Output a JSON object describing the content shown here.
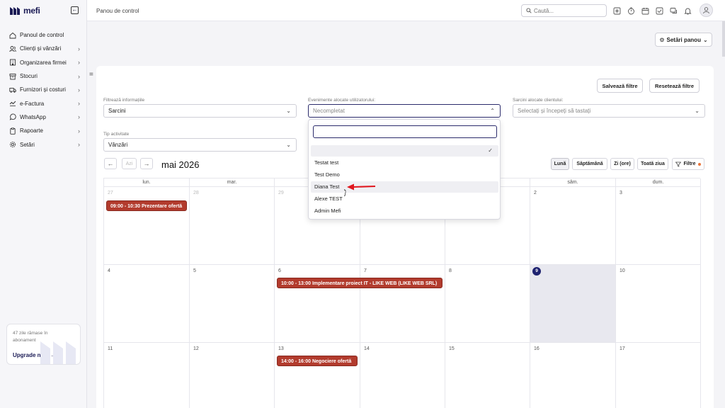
{
  "app": {
    "brand": "mefi"
  },
  "sidebar": {
    "items": [
      {
        "label": "Panoul de control",
        "icon": "home-icon",
        "chevron": false
      },
      {
        "label": "Clienți și vânzări",
        "icon": "users-icon",
        "chevron": true
      },
      {
        "label": "Organizarea firmei",
        "icon": "building-icon",
        "chevron": true
      },
      {
        "label": "Stocuri",
        "icon": "box-icon",
        "chevron": true
      },
      {
        "label": "Furnizori și costuri",
        "icon": "truck-icon",
        "chevron": true
      },
      {
        "label": "e-Factura",
        "icon": "efactura-icon",
        "chevron": true
      },
      {
        "label": "WhatsApp",
        "icon": "whatsapp-icon",
        "chevron": true
      },
      {
        "label": "Rapoarte",
        "icon": "report-icon",
        "chevron": true
      },
      {
        "label": "Setări",
        "icon": "gear-icon",
        "chevron": true
      }
    ],
    "upgrade": {
      "days_text": "47 zile rămase în abonament",
      "cta": "Upgrade now"
    }
  },
  "topbar": {
    "breadcrumb": "Panou de control",
    "search_placeholder": "Caută..."
  },
  "content": {
    "settings_button": "Setări panou",
    "save_filters": "Salvează filtre",
    "reset_filters": "Resetează filtre",
    "filters": {
      "info_label": "Filtrează informațiile",
      "info_value": "Sarcini",
      "events_label": "Evenimente alocate utilizatorului:",
      "events_value": "Necompletat",
      "tasks_label": "Sarcini alocate clientului:",
      "tasks_placeholder": "Selectați și începeți să tastați",
      "activity_label": "Tip activitate",
      "activity_value": "Vânzări"
    },
    "calendar": {
      "today_button": "Azi",
      "month": "mai 2026",
      "views": [
        "Lună",
        "Săptămână",
        "Zi (ore)",
        "Toată ziua",
        "Filtre"
      ],
      "weekdays": [
        "lun.",
        "mar.",
        "mie.",
        "joi",
        "vin.",
        "sâm.",
        "dum."
      ],
      "weeks": [
        [
          "27",
          "28",
          "29",
          "30",
          "1",
          "2",
          "3"
        ],
        [
          "4",
          "5",
          "6",
          "7",
          "8",
          "9",
          "10"
        ],
        [
          "11",
          "12",
          "13",
          "14",
          "15",
          "16",
          "17"
        ]
      ],
      "events": [
        "09:00 - 10:30 Prezentare ofertă",
        "10:00 - 13:00 Implementare proiect IT - LIKE WEB (LIKE WEB SRL)",
        "14:00 - 16:00 Negociere ofertă"
      ]
    },
    "dropdown": {
      "options": [
        "Testat test",
        "Test Demo",
        "Diana Test",
        "Alexe TEST",
        "Admin Mefi"
      ]
    }
  },
  "colors": {
    "brand": "#1b1b55",
    "event": "#b23b2d",
    "today": "#1e2270",
    "arrow": "#e0161e"
  }
}
